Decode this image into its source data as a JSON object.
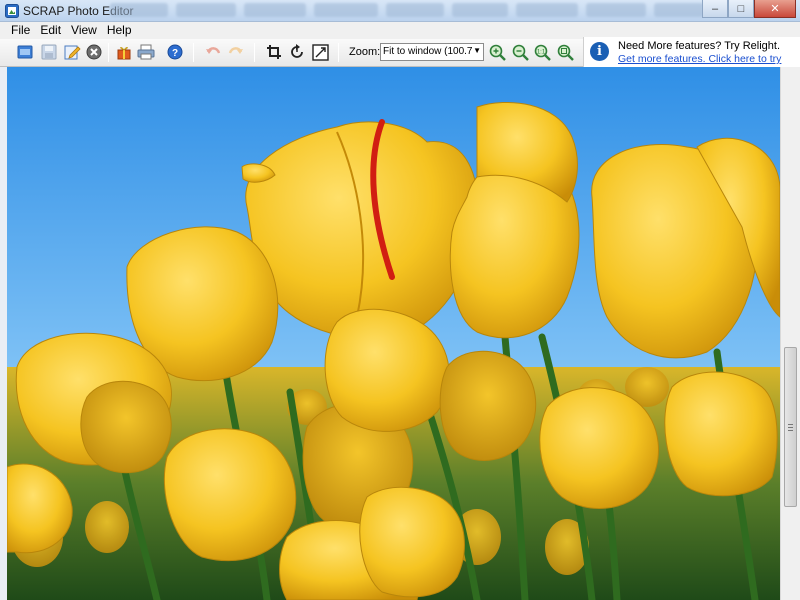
{
  "window": {
    "title": "SCRAP Photo Editor",
    "controls": {
      "minimize": "–",
      "maximize": "□",
      "close": "✕"
    }
  },
  "menu": {
    "items": [
      "File",
      "Edit",
      "View",
      "Help"
    ]
  },
  "toolbar": {
    "buttons": [
      "open-icon",
      "save-icon",
      "edit-icon",
      "close-image-icon",
      "gift-icon",
      "print-icon",
      "help-icon",
      "undo-icon",
      "redo-icon",
      "crop-icon",
      "rotate-icon",
      "resize-icon",
      "zoom-in-icon",
      "zoom-out-icon",
      "zoom-actual-icon",
      "zoom-fit-icon"
    ],
    "zoom_label": "Zoom:",
    "zoom_value": "Fit to window (100.7"
  },
  "info_panel": {
    "title": "Need More features? Try Relight.",
    "link": "Get more features. Click here to try"
  },
  "canvas": {
    "image_subject": "yellow tulips against blue sky"
  },
  "colors": {
    "accent": "#1a5fb4",
    "link": "#1a4fd0",
    "sky": "#4aa6ee",
    "tulip": "#f2c21c"
  }
}
